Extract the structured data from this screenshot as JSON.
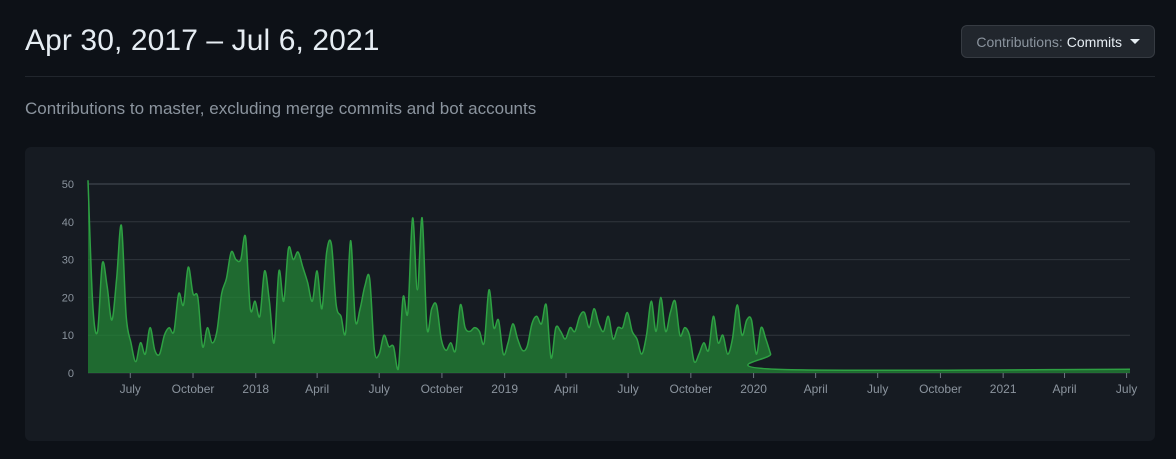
{
  "header": {
    "title": "Apr 30, 2017 – Jul 6, 2021",
    "contributions_label": "Contributions:",
    "contributions_value": "Commits"
  },
  "subtitle": "Contributions to master, excluding merge commits and bot accounts",
  "colors": {
    "background": "#0d1117",
    "panel": "#161b22",
    "area_fill": "#238636",
    "area_line": "#2ea043",
    "grid": "#30363d",
    "axis_text": "#8b949e"
  },
  "chart_data": {
    "type": "area",
    "ylim": [
      0,
      50
    ],
    "y_ticks": [
      0,
      10,
      20,
      30,
      40,
      50
    ],
    "x_range": [
      "2017-04-30",
      "2021-07-06"
    ],
    "x_tick_labels": [
      {
        "label": "July",
        "date": "2017-07-01"
      },
      {
        "label": "October",
        "date": "2017-10-01"
      },
      {
        "label": "2018",
        "date": "2018-01-01"
      },
      {
        "label": "April",
        "date": "2018-04-01"
      },
      {
        "label": "July",
        "date": "2018-07-01"
      },
      {
        "label": "October",
        "date": "2018-10-01"
      },
      {
        "label": "2019",
        "date": "2019-01-01"
      },
      {
        "label": "April",
        "date": "2019-04-01"
      },
      {
        "label": "July",
        "date": "2019-07-01"
      },
      {
        "label": "October",
        "date": "2019-10-01"
      },
      {
        "label": "2020",
        "date": "2020-01-01"
      },
      {
        "label": "April",
        "date": "2020-04-01"
      },
      {
        "label": "July",
        "date": "2020-07-01"
      },
      {
        "label": "October",
        "date": "2020-10-01"
      },
      {
        "label": "2021",
        "date": "2021-01-01"
      },
      {
        "label": "April",
        "date": "2021-04-01"
      },
      {
        "label": "July",
        "date": "2021-07-01"
      }
    ],
    "grid": true,
    "points": [
      [
        "2017-04-30",
        51
      ],
      [
        "2017-05-07",
        18
      ],
      [
        "2017-05-14",
        11
      ],
      [
        "2017-05-21",
        29
      ],
      [
        "2017-05-28",
        23
      ],
      [
        "2017-06-04",
        14
      ],
      [
        "2017-06-11",
        25
      ],
      [
        "2017-06-18",
        39
      ],
      [
        "2017-06-25",
        15
      ],
      [
        "2017-07-02",
        8
      ],
      [
        "2017-07-09",
        3
      ],
      [
        "2017-07-16",
        8
      ],
      [
        "2017-07-23",
        5
      ],
      [
        "2017-07-30",
        12
      ],
      [
        "2017-08-06",
        6
      ],
      [
        "2017-08-13",
        5
      ],
      [
        "2017-08-20",
        10
      ],
      [
        "2017-08-27",
        12
      ],
      [
        "2017-09-03",
        11
      ],
      [
        "2017-09-10",
        21
      ],
      [
        "2017-09-17",
        18
      ],
      [
        "2017-09-24",
        28
      ],
      [
        "2017-10-01",
        21
      ],
      [
        "2017-10-08",
        20
      ],
      [
        "2017-10-15",
        7
      ],
      [
        "2017-10-22",
        12
      ],
      [
        "2017-10-29",
        8
      ],
      [
        "2017-11-05",
        11
      ],
      [
        "2017-11-12",
        21
      ],
      [
        "2017-11-19",
        25
      ],
      [
        "2017-11-26",
        32
      ],
      [
        "2017-12-03",
        30
      ],
      [
        "2017-12-10",
        30
      ],
      [
        "2017-12-17",
        36
      ],
      [
        "2017-12-24",
        17
      ],
      [
        "2017-12-31",
        19
      ],
      [
        "2018-01-07",
        15
      ],
      [
        "2018-01-14",
        27
      ],
      [
        "2018-01-21",
        19
      ],
      [
        "2018-01-28",
        8
      ],
      [
        "2018-02-04",
        27
      ],
      [
        "2018-02-11",
        19
      ],
      [
        "2018-02-18",
        33
      ],
      [
        "2018-02-25",
        30
      ],
      [
        "2018-03-04",
        32
      ],
      [
        "2018-03-11",
        28
      ],
      [
        "2018-03-18",
        24
      ],
      [
        "2018-03-25",
        19
      ],
      [
        "2018-04-01",
        27
      ],
      [
        "2018-04-08",
        17
      ],
      [
        "2018-04-15",
        32
      ],
      [
        "2018-04-22",
        34
      ],
      [
        "2018-04-29",
        18
      ],
      [
        "2018-05-06",
        15
      ],
      [
        "2018-05-13",
        11
      ],
      [
        "2018-05-20",
        35
      ],
      [
        "2018-05-27",
        14
      ],
      [
        "2018-06-03",
        17
      ],
      [
        "2018-06-10",
        23
      ],
      [
        "2018-06-17",
        25
      ],
      [
        "2018-06-24",
        6
      ],
      [
        "2018-07-01",
        5
      ],
      [
        "2018-07-08",
        10
      ],
      [
        "2018-07-15",
        7
      ],
      [
        "2018-07-22",
        7
      ],
      [
        "2018-07-29",
        1
      ],
      [
        "2018-08-05",
        20
      ],
      [
        "2018-08-12",
        16
      ],
      [
        "2018-08-19",
        41
      ],
      [
        "2018-08-26",
        22
      ],
      [
        "2018-09-02",
        41
      ],
      [
        "2018-09-09",
        12
      ],
      [
        "2018-09-16",
        17
      ],
      [
        "2018-09-23",
        18
      ],
      [
        "2018-09-30",
        9
      ],
      [
        "2018-10-07",
        6
      ],
      [
        "2018-10-14",
        8
      ],
      [
        "2018-10-21",
        6
      ],
      [
        "2018-10-28",
        18
      ],
      [
        "2018-11-04",
        12
      ],
      [
        "2018-11-11",
        11
      ],
      [
        "2018-11-18",
        12
      ],
      [
        "2018-11-25",
        11
      ],
      [
        "2018-12-02",
        8
      ],
      [
        "2018-12-09",
        22
      ],
      [
        "2018-12-16",
        12
      ],
      [
        "2018-12-23",
        14
      ],
      [
        "2018-12-30",
        5
      ],
      [
        "2019-01-06",
        8
      ],
      [
        "2019-01-13",
        13
      ],
      [
        "2019-01-20",
        9
      ],
      [
        "2019-01-27",
        6
      ],
      [
        "2019-02-03",
        7
      ],
      [
        "2019-02-10",
        13
      ],
      [
        "2019-02-17",
        15
      ],
      [
        "2019-02-24",
        13
      ],
      [
        "2019-03-03",
        18
      ],
      [
        "2019-03-10",
        4
      ],
      [
        "2019-03-17",
        12
      ],
      [
        "2019-03-24",
        11
      ],
      [
        "2019-03-31",
        9
      ],
      [
        "2019-04-07",
        12
      ],
      [
        "2019-04-14",
        11
      ],
      [
        "2019-04-21",
        15
      ],
      [
        "2019-04-28",
        16
      ],
      [
        "2019-05-05",
        12
      ],
      [
        "2019-05-12",
        17
      ],
      [
        "2019-05-19",
        13
      ],
      [
        "2019-05-26",
        11
      ],
      [
        "2019-06-02",
        15
      ],
      [
        "2019-06-09",
        9
      ],
      [
        "2019-06-16",
        12
      ],
      [
        "2019-06-23",
        12
      ],
      [
        "2019-06-30",
        16
      ],
      [
        "2019-07-07",
        11
      ],
      [
        "2019-07-14",
        9
      ],
      [
        "2019-07-21",
        5
      ],
      [
        "2019-07-28",
        10
      ],
      [
        "2019-08-04",
        19
      ],
      [
        "2019-08-11",
        11
      ],
      [
        "2019-08-18",
        20
      ],
      [
        "2019-08-25",
        11
      ],
      [
        "2019-09-01",
        16
      ],
      [
        "2019-09-08",
        19
      ],
      [
        "2019-09-15",
        10
      ],
      [
        "2019-09-22",
        12
      ],
      [
        "2019-09-29",
        10
      ],
      [
        "2019-10-06",
        3
      ],
      [
        "2019-10-13",
        5
      ],
      [
        "2019-10-20",
        8
      ],
      [
        "2019-10-27",
        6
      ],
      [
        "2019-11-03",
        15
      ],
      [
        "2019-11-10",
        8
      ],
      [
        "2019-11-17",
        10
      ],
      [
        "2019-11-24",
        5
      ],
      [
        "2019-12-01",
        9
      ],
      [
        "2019-12-08",
        18
      ],
      [
        "2019-12-15",
        10
      ],
      [
        "2019-12-22",
        14
      ],
      [
        "2019-12-29",
        14
      ],
      [
        "2020-01-05",
        5
      ],
      [
        "2020-01-12",
        12
      ],
      [
        "2020-01-19",
        9
      ],
      [
        "2020-01-26",
        5
      ],
      [
        "2020-02-02",
        1
      ]
    ]
  }
}
